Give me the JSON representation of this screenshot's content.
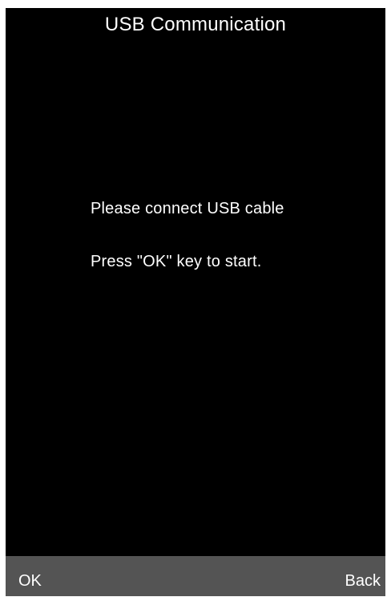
{
  "screen": {
    "title": "USB Communication"
  },
  "message": {
    "line1": "Please connect USB cable",
    "line2": "Press \"OK\" key to start."
  },
  "softkeys": {
    "left_label": "OK",
    "right_label": "Back"
  },
  "colors": {
    "screen_background": "#000000",
    "softkey_bar_background": "#545454",
    "text": "#ffffff"
  }
}
